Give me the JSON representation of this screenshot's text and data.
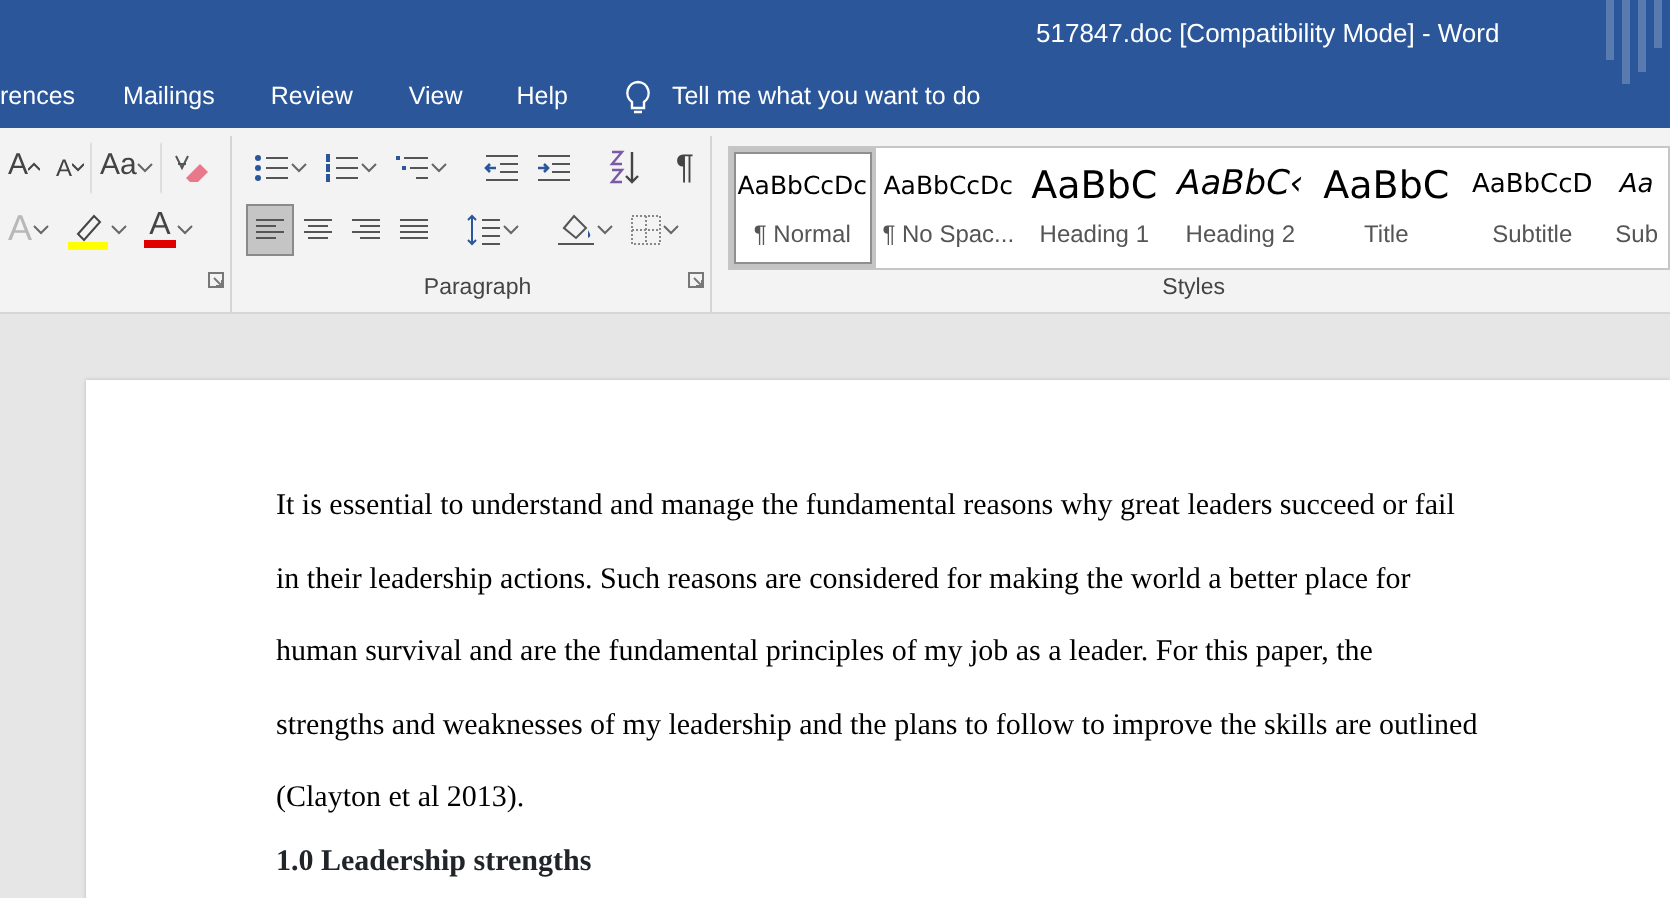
{
  "window": {
    "title": "517847.doc [Compatibility Mode]  -  Word"
  },
  "tabs": [
    {
      "label": "rences",
      "selected": false
    },
    {
      "label": "Mailings",
      "selected": false
    },
    {
      "label": "Review",
      "selected": false
    },
    {
      "label": "View",
      "selected": false
    },
    {
      "label": "Help",
      "selected": false
    }
  ],
  "tell_me": {
    "placeholder": "Tell me what you want to do"
  },
  "font_group": {
    "row_1": [
      {
        "kind": "grow",
        "glyph": "A"
      },
      {
        "kind": "shrink",
        "glyph": "A"
      },
      {
        "kind": "case",
        "glyph": "Aa"
      },
      {
        "kind": "clear"
      }
    ],
    "row_2": [
      {
        "kind": "effects",
        "glyph": "A",
        "disabled": true
      },
      {
        "kind": "highlight"
      },
      {
        "kind": "font_color",
        "glyph": "A"
      }
    ]
  },
  "paragraph_group": {
    "label": "Paragraph",
    "row_1": [
      {
        "kind": "bullets"
      },
      {
        "kind": "numbering"
      },
      {
        "kind": "multilevel"
      },
      {
        "kind": "outdent"
      },
      {
        "kind": "indent"
      },
      {
        "kind": "sort"
      },
      {
        "kind": "marks",
        "glyph": "¶"
      }
    ],
    "row_2": [
      {
        "kind": "align_left",
        "selected": true
      },
      {
        "kind": "align_center",
        "selected": false
      },
      {
        "kind": "align_right",
        "selected": false
      },
      {
        "kind": "justify",
        "selected": false
      },
      {
        "kind": "spacing"
      },
      {
        "kind": "shading"
      },
      {
        "kind": "borders"
      }
    ]
  },
  "styles_group": {
    "label": "Styles",
    "items": [
      {
        "kind": "normal",
        "sample": "AaBbCcDc",
        "name": "¶ Normal",
        "selected": true
      },
      {
        "kind": "normal",
        "sample": "AaBbCcDc",
        "name": "¶ No Spac...",
        "selected": false
      },
      {
        "kind": "heading1",
        "sample": "AaBbC",
        "name": "Heading 1",
        "selected": false
      },
      {
        "kind": "heading2",
        "sample": "AaBbC‹",
        "name": "Heading 2",
        "selected": false
      },
      {
        "kind": "title",
        "sample": "AaBbC",
        "name": "Title",
        "selected": false
      },
      {
        "kind": "subtitle",
        "sample": "AaBbCcD",
        "name": "Subtitle",
        "selected": false
      },
      {
        "kind": "emphasis",
        "sample": "Aa",
        "name": "Sub",
        "selected": false
      }
    ]
  },
  "document": {
    "blocks": [
      {
        "kind": "paragraph",
        "text": "It is essential to understand and manage the fundamental reasons why great leaders succeed or fail in their leadership actions. Such reasons are considered for making the world a better place for human survival and are the fundamental principles of my job as a leader. For this paper, the strengths and weaknesses of my leadership and the plans to follow to improve the skills are outlined (Clayton et al 2013)."
      },
      {
        "kind": "heading",
        "text": "1.0 Leadership strengths"
      }
    ]
  }
}
